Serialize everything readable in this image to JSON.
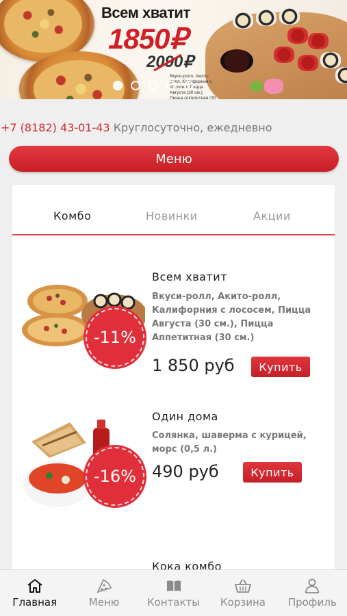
{
  "banner": {
    "title": "Всем хватит",
    "price": "1850₽",
    "old_price": "2090₽",
    "small_text": "Вкуси-ролл, Акито-ролл, Калифорния с лососем, Пицца Августа (30 см.), Пицца Аппетитная (30 см.)",
    "slide_count": 5,
    "active_slide": 1
  },
  "contact": {
    "phone": "+7 (8182) 43-01-43",
    "hours": "Круглосуточно, ежедневно"
  },
  "menu_button": {
    "label": "Меню"
  },
  "tabs": [
    {
      "label": "Комбо",
      "active": true
    },
    {
      "label": "Новинки",
      "active": false
    },
    {
      "label": "Акции",
      "active": false
    }
  ],
  "items": [
    {
      "name": "Всем хватит",
      "description": "Вкуси-ролл, Акито-ролл, Калифорния с лососем, Пицца Августа (30 см.), Пицца Аппетитная (30 см.)",
      "price": "1 850 руб",
      "discount": "-11%",
      "buy_label": "Купить"
    },
    {
      "name": "Один дома",
      "description": "Солянка, шаверма с курицей, морс (0,5 л.)",
      "price": "490 руб",
      "discount": "-16%",
      "buy_label": "Купить"
    },
    {
      "name": "Кока комбо"
    }
  ],
  "bottom_nav": [
    {
      "label": "Главная",
      "icon": "home-icon",
      "active": true
    },
    {
      "label": "Меню",
      "icon": "pizza-slice-icon",
      "active": false
    },
    {
      "label": "Контакты",
      "icon": "book-icon",
      "active": false
    },
    {
      "label": "Корзина",
      "icon": "basket-icon",
      "active": false
    },
    {
      "label": "Профиль",
      "icon": "user-icon",
      "active": false
    }
  ],
  "colors": {
    "accent": "#d0282e",
    "background": "#efeff0"
  }
}
